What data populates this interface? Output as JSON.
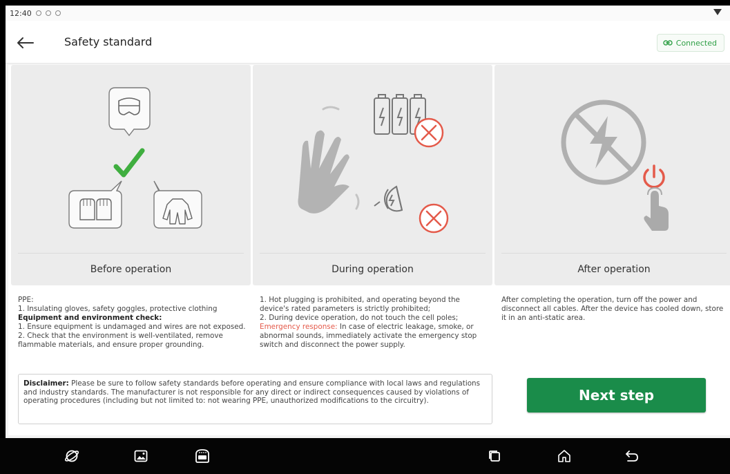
{
  "status_bar": {
    "time": "12:40"
  },
  "header": {
    "title": "Safety standard",
    "connection_status": "Connected"
  },
  "panels": [
    {
      "caption": "Before operation"
    },
    {
      "caption": "During operation"
    },
    {
      "caption": "After operation"
    }
  ],
  "before": {
    "ppe_heading": "PPE:",
    "ppe_1": "1. Insulating gloves, safety goggles, protective clothing",
    "check_heading": "Equipment and environment check:",
    "check_1": "1. Ensure equipment is undamaged and wires are not exposed.",
    "check_2": "2. Check that the environment is well-ventilated, remove flammable materials, and ensure proper grounding."
  },
  "during": {
    "item_1": "1. Hot plugging is prohibited, and operating beyond the device's rated parameters is strictly prohibited;",
    "item_2": "2. During device operation, do not touch the cell poles;",
    "emergency_label": "Emergency response:",
    "emergency_text": " In case of electric leakage, smoke, or abnormal sounds, immediately activate the emergency stop switch and disconnect the power supply."
  },
  "after": {
    "text": "After completing the operation, turn off the power and disconnect all cables. After the device has cooled down, store it in an anti-static area."
  },
  "disclaimer": {
    "label": "Disclaimer:",
    "text": " Please be sure to follow safety standards before operating and ensure compliance with local laws and regulations and industry standards. The manufacturer is not responsible for any direct or indirect consequences caused by violations of operating procedures (including but not limited to: not wearing PPE, unauthorized modifications to the circuitry)."
  },
  "actions": {
    "next_label": "Next step"
  },
  "colors": {
    "accent": "#1a8c4a",
    "connected": "#2e9f45",
    "warning": "#e45a4a"
  },
  "icons": [
    "back-arrow-icon",
    "link-icon",
    "browser-icon",
    "gallery-icon",
    "vci-icon",
    "recents-icon",
    "home-icon",
    "back-icon"
  ]
}
